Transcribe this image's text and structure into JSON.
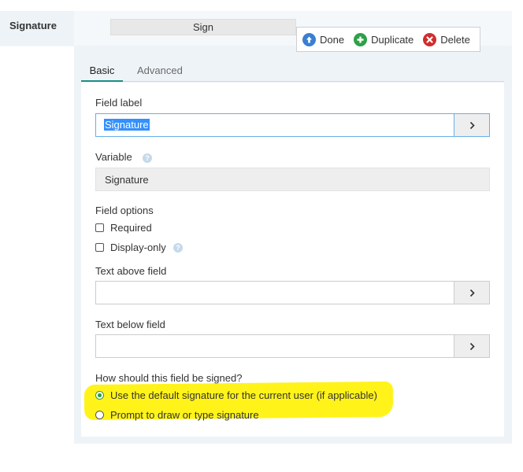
{
  "header": {
    "field_type": "Signature",
    "sign_label": "Sign"
  },
  "actions": {
    "done": "Done",
    "duplicate": "Duplicate",
    "delete": "Delete"
  },
  "tabs": [
    {
      "label": "Basic",
      "active": true
    },
    {
      "label": "Advanced",
      "active": false
    }
  ],
  "form": {
    "field_label": {
      "label": "Field label",
      "value": "Signature"
    },
    "variable": {
      "label": "Variable",
      "value": "Signature"
    },
    "field_options": {
      "label": "Field options",
      "options": [
        {
          "label": "Required",
          "checked": false
        },
        {
          "label": "Display-only",
          "checked": false
        }
      ]
    },
    "text_above": {
      "label": "Text above field",
      "value": ""
    },
    "text_below": {
      "label": "Text below field",
      "value": ""
    },
    "signing": {
      "label": "How should this field be signed?",
      "options": [
        {
          "label": "Use the default signature for the current user (if applicable)",
          "selected": true
        },
        {
          "label": "Prompt to draw or type signature",
          "selected": false
        }
      ]
    }
  },
  "colors": {
    "accent": "#1a8f86",
    "highlight": "#fff31a",
    "done_icon": "#3a7fd0",
    "duplicate_icon": "#2ca147",
    "delete_icon": "#d02d2d"
  }
}
